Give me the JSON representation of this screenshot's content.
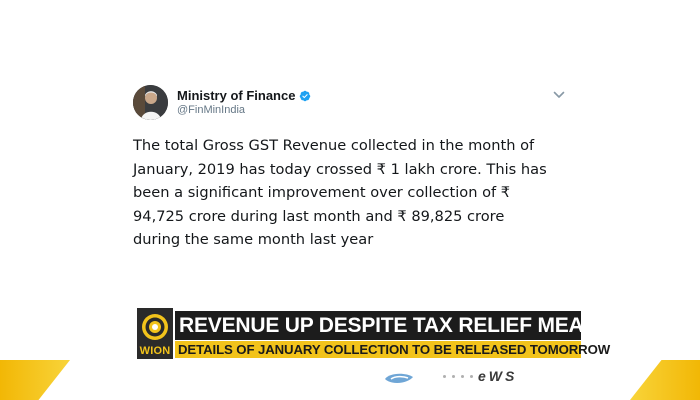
{
  "tweet": {
    "author_name": "Ministry of Finance",
    "author_handle": "@FinMinIndia",
    "text": "The total Gross GST Revenue collected in the month of\nJanuary, 2019 has today crossed ₹ 1 lakh crore. This has\nbeen a significant improvement over collection of ₹\n94,725 crore during last month and ₹ 89,825 crore\nduring the same month last year",
    "verified_color": "#1da1f2"
  },
  "ticker": {
    "logo_text": "WION",
    "headline": "REVENUE UP DESPITE TAX RELIEF MEASURES",
    "subheadline": "DETAILS OF JANUARY COLLECTION TO BE RELEASED TOMORROW",
    "accent_color": "#f2c31b",
    "dark_color": "#1c1c1c"
  },
  "bottom_bar": {
    "news_text": "eWS"
  }
}
